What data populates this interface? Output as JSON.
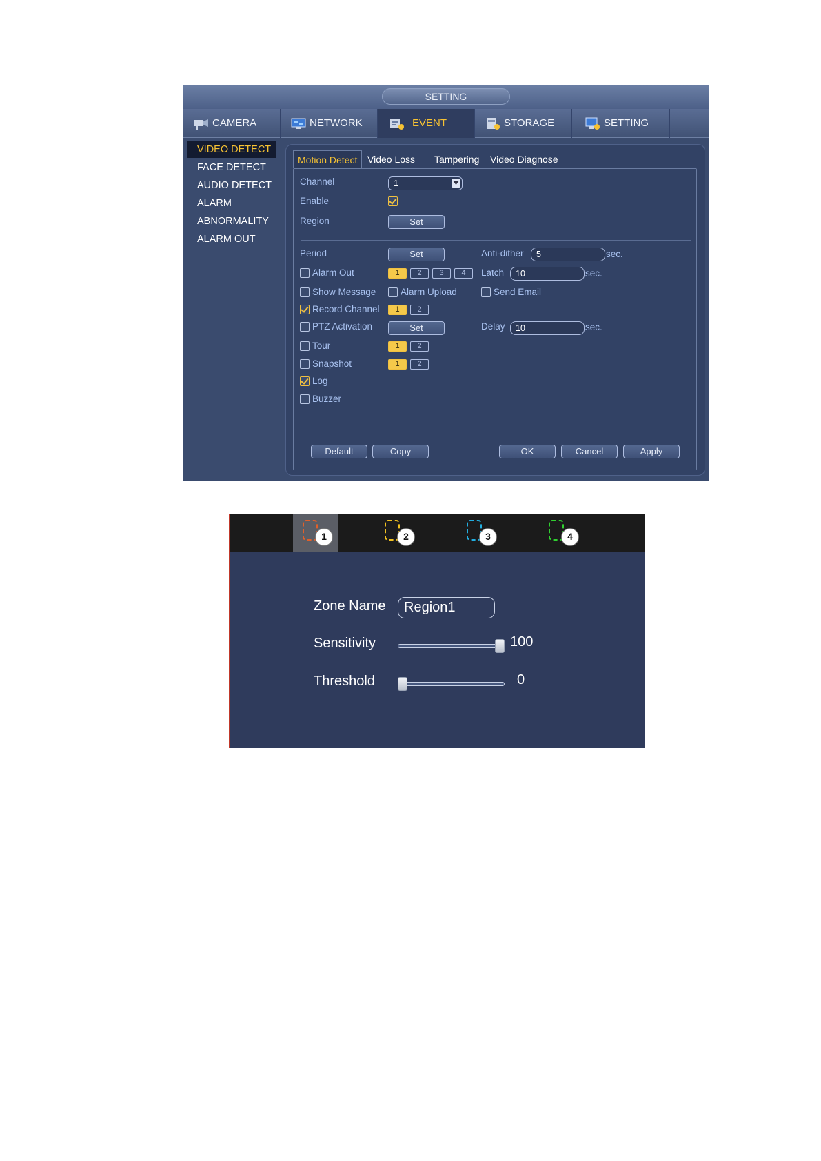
{
  "window": {
    "title": "SETTING",
    "main_tabs": [
      {
        "label": "CAMERA",
        "icon": "camera-icon",
        "active": false
      },
      {
        "label": "NETWORK",
        "icon": "network-icon",
        "active": false
      },
      {
        "label": "EVENT",
        "icon": "event-icon",
        "active": true
      },
      {
        "label": "STORAGE",
        "icon": "storage-icon",
        "active": false
      },
      {
        "label": "SETTING",
        "icon": "setting-icon",
        "active": false
      }
    ],
    "sidebar": [
      {
        "label": "VIDEO DETECT",
        "active": true
      },
      {
        "label": "FACE DETECT",
        "active": false
      },
      {
        "label": "AUDIO DETECT",
        "active": false
      },
      {
        "label": "ALARM",
        "active": false
      },
      {
        "label": "ABNORMALITY",
        "active": false
      },
      {
        "label": "ALARM OUT",
        "active": false
      }
    ],
    "sub_tabs": [
      {
        "label": "Motion Detect",
        "active": true
      },
      {
        "label": "Video Loss",
        "active": false
      },
      {
        "label": "Tampering",
        "active": false
      },
      {
        "label": "Video Diagnose",
        "active": false
      }
    ],
    "form": {
      "channel_label": "Channel",
      "channel_value": "1",
      "enable_label": "Enable",
      "enable_checked": true,
      "region_label": "Region",
      "region_button": "Set",
      "period_label": "Period",
      "period_button": "Set",
      "antidither_label": "Anti-dither",
      "antidither_value": "5",
      "antidither_unit": "sec.",
      "alarm_out_label": "Alarm Out",
      "alarm_out_checked": false,
      "alarm_out_channels": [
        {
          "n": "1",
          "on": true
        },
        {
          "n": "2",
          "on": false
        },
        {
          "n": "3",
          "on": false
        },
        {
          "n": "4",
          "on": false
        }
      ],
      "latch_label": "Latch",
      "latch_value": "10",
      "latch_unit": "sec.",
      "show_message_label": "Show Message",
      "show_message_checked": false,
      "alarm_upload_label": "Alarm Upload",
      "alarm_upload_checked": false,
      "send_email_label": "Send Email",
      "send_email_checked": false,
      "record_channel_label": "Record Channel",
      "record_channel_checked": true,
      "record_channels": [
        {
          "n": "1",
          "on": true
        },
        {
          "n": "2",
          "on": false
        }
      ],
      "ptz_label": "PTZ Activation",
      "ptz_checked": false,
      "ptz_button": "Set",
      "delay_label": "Delay",
      "delay_value": "10",
      "delay_unit": "sec.",
      "tour_label": "Tour",
      "tour_checked": false,
      "tour_channels": [
        {
          "n": "1",
          "on": true
        },
        {
          "n": "2",
          "on": false
        }
      ],
      "snapshot_label": "Snapshot",
      "snapshot_checked": false,
      "snapshot_channels": [
        {
          "n": "1",
          "on": true
        },
        {
          "n": "2",
          "on": false
        }
      ],
      "log_label": "Log",
      "log_checked": true,
      "buzzer_label": "Buzzer",
      "buzzer_checked": false
    },
    "buttons": {
      "default": "Default",
      "copy": "Copy",
      "ok": "OK",
      "cancel": "Cancel",
      "apply": "Apply"
    }
  },
  "region_editor": {
    "zones": [
      {
        "n": "1",
        "color": "#e0602a",
        "active": true
      },
      {
        "n": "2",
        "color": "#f0c020",
        "active": false
      },
      {
        "n": "3",
        "color": "#22aee0",
        "active": false
      },
      {
        "n": "4",
        "color": "#30d030",
        "active": false
      }
    ],
    "zone_name_label": "Zone Name",
    "zone_name_value": "Region1",
    "sensitivity_label": "Sensitivity",
    "sensitivity_value": 100,
    "sensitivity_max": 100,
    "threshold_label": "Threshold",
    "threshold_value": 0,
    "threshold_max": 100
  }
}
